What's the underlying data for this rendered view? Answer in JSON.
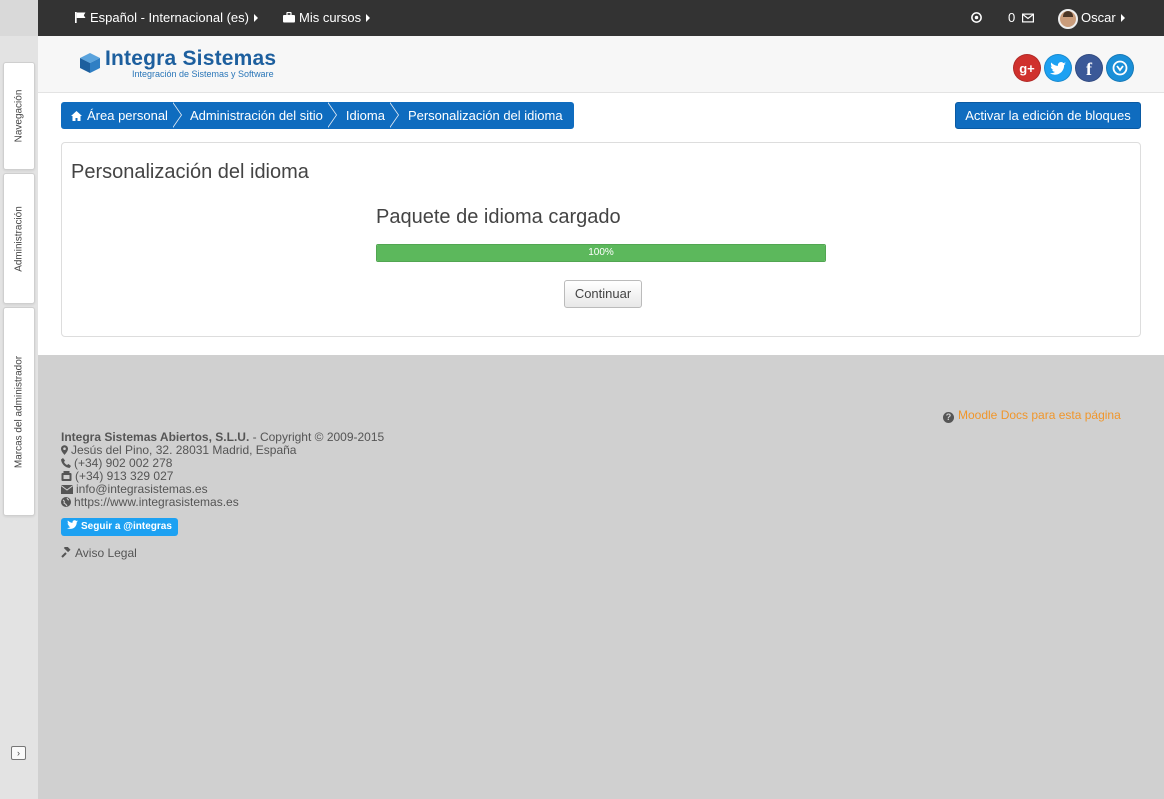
{
  "navbar": {
    "language": "Español - Internacional (es)",
    "courses": "Mis cursos",
    "messages_count": "0",
    "user": "Oscar"
  },
  "header": {
    "logo_title": "Integra Sistemas",
    "logo_subtitle": "Integración de Sistemas y Software",
    "social": [
      {
        "name": "google-plus",
        "glyph": "g+",
        "color": "#d0312d"
      },
      {
        "name": "twitter",
        "glyph": "t",
        "color": "#1da1f2"
      },
      {
        "name": "facebook",
        "glyph": "f",
        "color": "#3b5998"
      },
      {
        "name": "other",
        "glyph": "◉",
        "color": "#1a8fd8"
      }
    ]
  },
  "dock": {
    "tabs": [
      "Navegación",
      "Administración",
      "Marcas del administrador"
    ]
  },
  "breadcrumb": [
    "Área personal",
    "Administración del sitio",
    "Idioma",
    "Personalización del idioma"
  ],
  "edit_button": "Activar la edición de bloques",
  "main": {
    "title": "Personalización del idioma",
    "subtitle": "Paquete de idioma cargado",
    "progress_percent": 100,
    "progress_label": "100%",
    "continue_button": "Continuar"
  },
  "footer": {
    "docs_link": "Moodle Docs para esta página",
    "company": "Integra Sistemas Abiertos, S.L.U.",
    "copyright": " - Copyright © 2009-2015",
    "address": "Jesús del Pino, 32. 28031 Madrid, España",
    "phone": "(+34) 902 002 278",
    "fax": "(+34) 913 329 027",
    "email": "info@integrasistemas.es",
    "website": "https://www.integrasistemas.es",
    "twitter_follow": "Seguir a @integras",
    "legal": "Aviso Legal"
  },
  "colors": {
    "navbar": "#333333",
    "brand_blue": "#0f6cbf",
    "progress_green": "#5cb85c",
    "docs_link": "#f0962b"
  }
}
